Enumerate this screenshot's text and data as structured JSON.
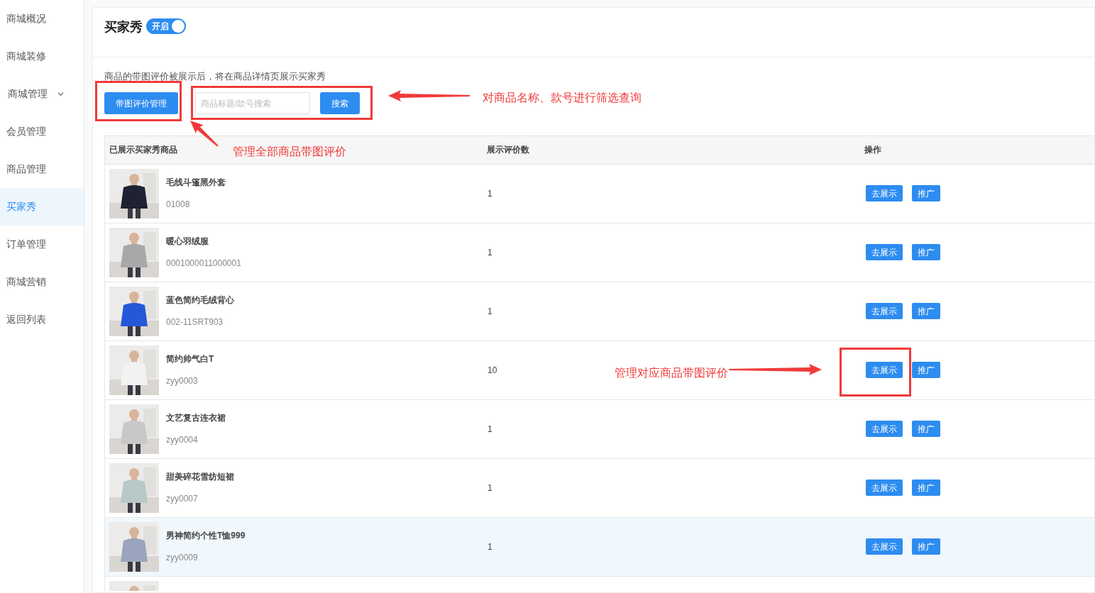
{
  "sidebar": {
    "items": [
      {
        "label": "商城概况",
        "selected": false
      },
      {
        "label": "商城装修",
        "selected": false
      },
      {
        "label": "商城管理",
        "selected": false,
        "expanded": false,
        "kind": "group"
      },
      {
        "label": "会员管理",
        "selected": false
      },
      {
        "label": "商品管理",
        "selected": false
      },
      {
        "label": "买家秀",
        "selected": true
      },
      {
        "label": "订单管理",
        "selected": false
      },
      {
        "label": "商城营销",
        "selected": false
      },
      {
        "label": "返回列表",
        "selected": false
      }
    ]
  },
  "header": {
    "title": "买家秀",
    "toggle": {
      "label": "开启",
      "on": true
    }
  },
  "description": "商品的带图评价被展示后，将在商品详情页展示买家秀",
  "toolbar": {
    "manage_button": "带图评价管理",
    "search": {
      "placeholder": "商品标题/款号搜索"
    },
    "search_button": "搜索"
  },
  "table": {
    "columns": [
      "已展示买家秀商品",
      "展示评价数",
      "操作"
    ],
    "rows": [
      {
        "name": "毛线斗篷黑外套",
        "code": "01008",
        "count": "1",
        "show_button": "去展示",
        "promote_button": "推广",
        "highlighted": false,
        "color": "#1e2233"
      },
      {
        "name": "暖心羽绒服",
        "code": "0001000011000001",
        "count": "1",
        "show_button": "去展示",
        "promote_button": "推广",
        "highlighted": false,
        "color": "#a8a8a8"
      },
      {
        "name": "蓝色简约毛绒背心",
        "code": "002-11SRT903",
        "count": "1",
        "show_button": "去展示",
        "promote_button": "推广",
        "highlighted": false,
        "color": "#2458d8"
      },
      {
        "name": "简约帅气白T",
        "code": "zyy0003",
        "count": "10",
        "show_button": "去展示",
        "promote_button": "推广",
        "highlighted": false,
        "color": "#f2f2f2"
      },
      {
        "name": "文艺复古连衣裙",
        "code": "zyy0004",
        "count": "1",
        "show_button": "去展示",
        "promote_button": "推广",
        "highlighted": false,
        "color": "#c8c8c8"
      },
      {
        "name": "甜美碎花雪纺短裙",
        "code": "zyy0007",
        "count": "1",
        "show_button": "去展示",
        "promote_button": "推广",
        "highlighted": false,
        "color": "#b8c8c8"
      },
      {
        "name": "男神简约个性T恤999",
        "code": "zyy0009",
        "count": "1",
        "show_button": "去展示",
        "promote_button": "推广",
        "highlighted": true,
        "color": "#9aa4bc"
      }
    ]
  },
  "annotations": [
    {
      "kind": "search",
      "text": "对商品名称、款号进行筛选查询"
    },
    {
      "kind": "manage",
      "text": "管理全部商品带图评价"
    },
    {
      "kind": "row",
      "text": "管理对应商品带图评价"
    }
  ]
}
